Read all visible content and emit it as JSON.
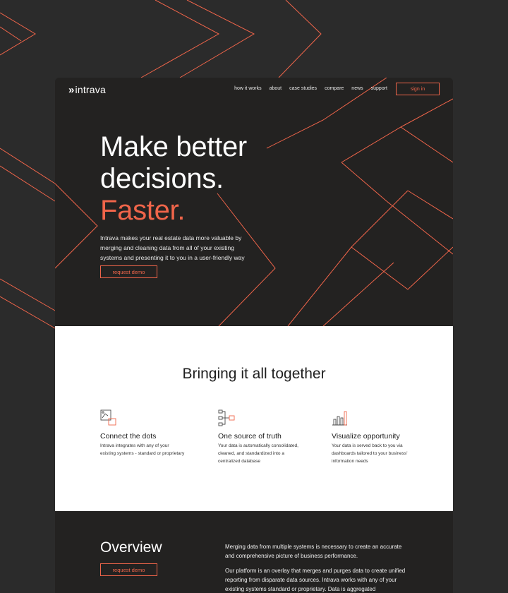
{
  "brand": {
    "logo_mark": "»",
    "name": "intrava"
  },
  "nav": {
    "links": [
      "how it works",
      "about",
      "case studies",
      "compare",
      "news",
      "support"
    ],
    "signin_label": "sign in"
  },
  "hero": {
    "headline_lines": [
      "Make better",
      "decisions."
    ],
    "headline_accent": "Faster.",
    "subtitle": "Intrava makes your real estate data more valuable by merging and cleaning data from all of your existing systems and presenting it to you in a user-friendly way",
    "cta_label": "request demo"
  },
  "features_section": {
    "title": "Bringing it all together",
    "items": [
      {
        "icon": "connect-dots-icon",
        "title": "Connect the dots",
        "text": "Intrava integrates with any of your existing systems - standard or proprietary"
      },
      {
        "icon": "source-of-truth-icon",
        "title": "One source of truth",
        "text": "Your data is automatically consolidated, cleaned, and standardized into a centralized database"
      },
      {
        "icon": "bar-chart-icon",
        "title": "Visualize opportunity",
        "text": "Your data is served back to you via dashboards tailored to your business' information needs"
      }
    ]
  },
  "overview": {
    "title": "Overview",
    "cta_label": "request demo",
    "paragraphs": [
      "Merging data from multiple systems is necessary to create an accurate and comprehensive picture of business performance.",
      "Our platform is an overlay that merges and purges data to create unified reporting from disparate data sources. Intrava works with any of your existing systems standard or proprietary. Data is aggregated"
    ]
  },
  "colors": {
    "accent": "#f0654a",
    "background": "#2b2b2b",
    "card": "#232221",
    "section_light": "#ffffff"
  }
}
